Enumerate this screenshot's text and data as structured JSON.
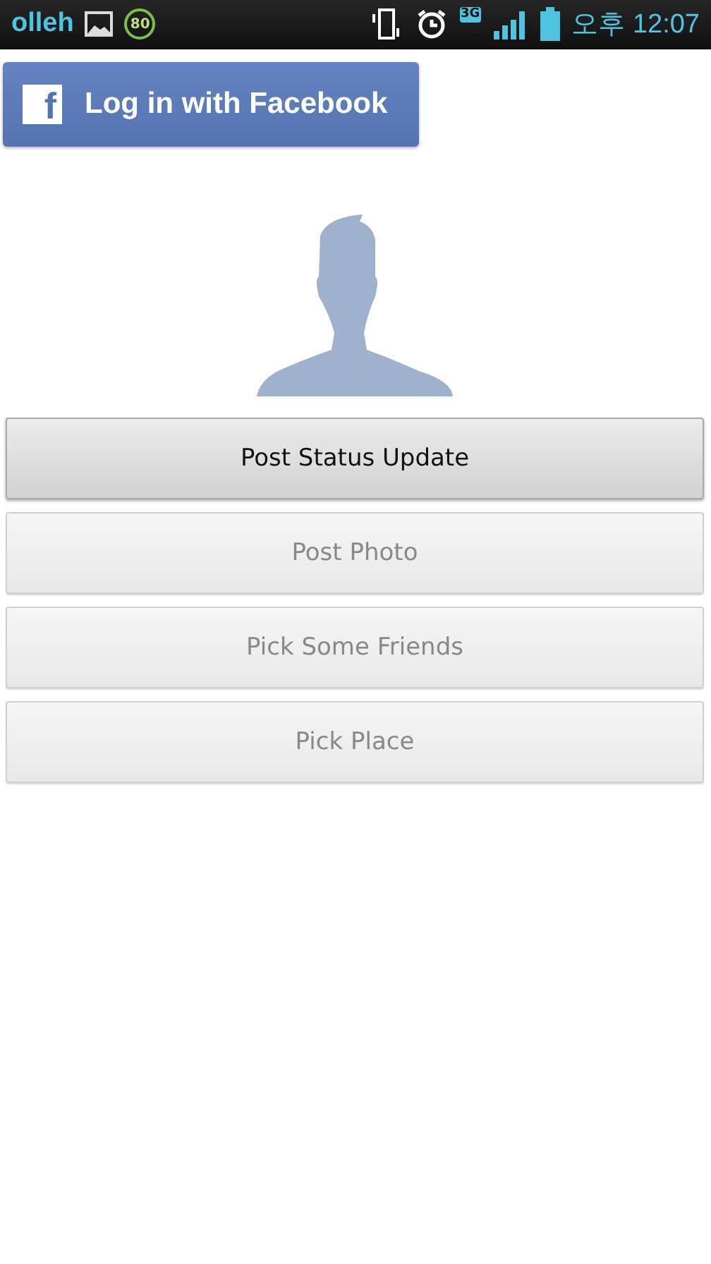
{
  "status_bar": {
    "carrier": "olleh",
    "badge": "80",
    "network": "3G",
    "time": "오후 12:07"
  },
  "login_button": {
    "logo": "f",
    "label": "Log in with Facebook"
  },
  "buttons": [
    {
      "label": "Post Status Update",
      "disabled": false
    },
    {
      "label": "Post Photo",
      "disabled": true
    },
    {
      "label": "Pick Some Friends",
      "disabled": true
    },
    {
      "label": "Pick Place",
      "disabled": true
    }
  ]
}
